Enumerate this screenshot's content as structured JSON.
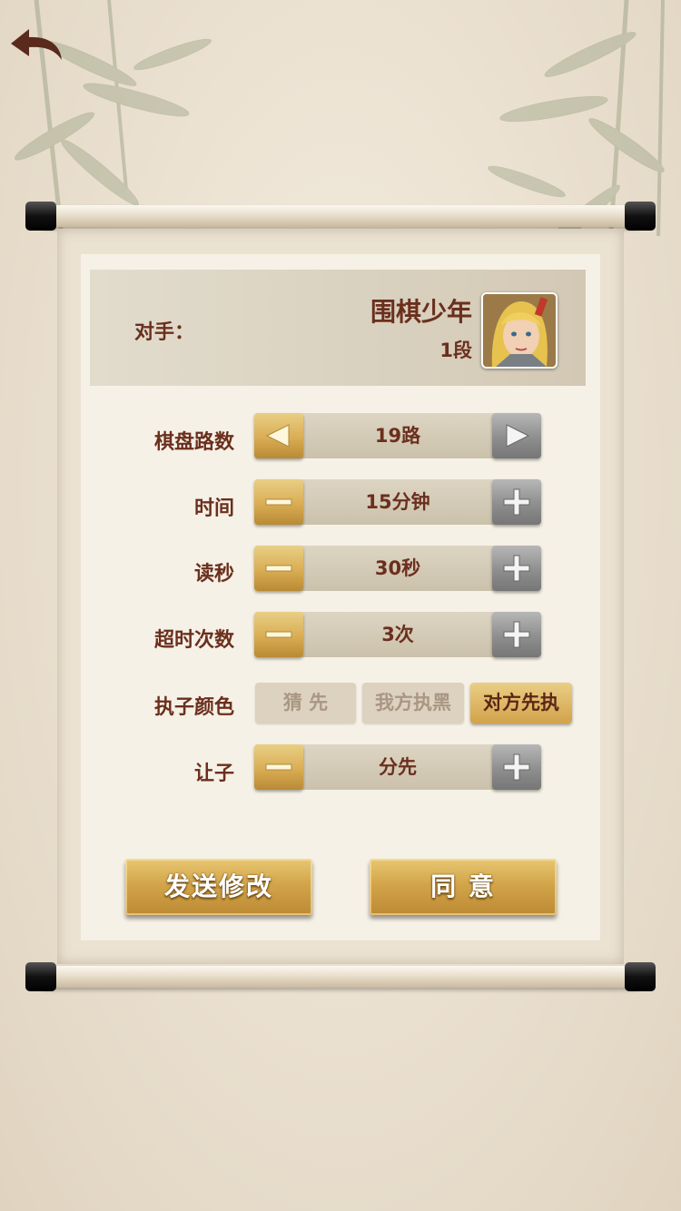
{
  "opponent": {
    "label": "对手：",
    "name": "围棋少年",
    "rank": "1段"
  },
  "settings": {
    "board_size": {
      "label": "棋盘路数",
      "value": "19路"
    },
    "time": {
      "label": "时间",
      "value": "15分钟"
    },
    "byoyomi": {
      "label": "读秒",
      "value": "30秒"
    },
    "timeouts": {
      "label": "超时次数",
      "value": "3次"
    },
    "color": {
      "label": "执子颜色",
      "options": [
        "猜 先",
        "我方执黑",
        "对方先执"
      ],
      "selected": "对方先执"
    },
    "handicap": {
      "label": "让子",
      "value": "分先"
    }
  },
  "actions": {
    "modify": "发送修改",
    "agree": "同 意"
  },
  "colors": {
    "label_text": "#6b2f1e",
    "gold": "#d9ad54",
    "grey_button": "#8e8e8e"
  }
}
